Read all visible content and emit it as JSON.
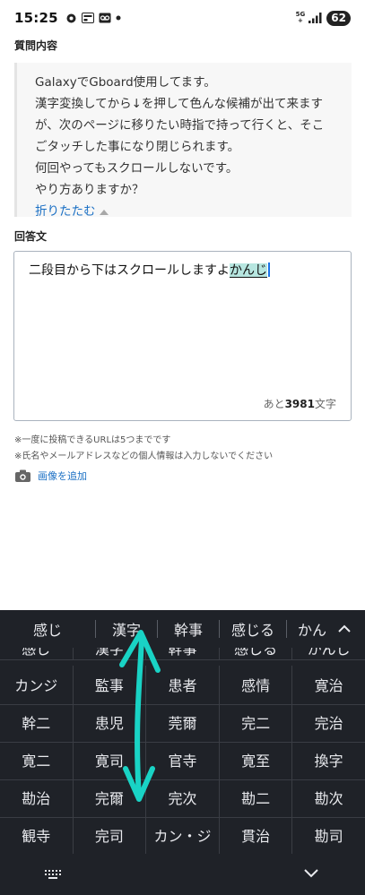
{
  "status_bar": {
    "time": "15:25",
    "network_top": "5G",
    "network_bottom": "+",
    "battery": "62"
  },
  "question": {
    "label": "質問内容",
    "lines": [
      "GalaxyでGboard使用してます。",
      "漢字変換してから↓を押して色んな候補が出て来ます",
      "が、次のページに移りたい時指で持って行くと、そこ",
      "ごタッチした事になり閉じられます。",
      "何回やってもスクロールしないです。",
      "やり方ありますか？"
    ],
    "collapse_label": "折りたたむ"
  },
  "answer": {
    "label": "回答文",
    "text_committed": "二段目から下はスクロールしますよ",
    "text_composing": "かんじ",
    "count_prefix": "あと",
    "count_value": "3981",
    "count_suffix": "文字"
  },
  "notes": [
    "※一度に投稿できるURLは5つまでです",
    "※氏名やメールアドレスなどの個人情報は入力しないでください"
  ],
  "add_image_label": "画像を追加",
  "keyboard": {
    "suggestions": [
      "感じ",
      "漢字",
      "幹事",
      "感じる",
      "かん"
    ],
    "partial_row": [
      "感じ",
      "漢字",
      "幹事",
      "感じる",
      "かんじ"
    ],
    "candidate_rows": [
      [
        "カンジ",
        "監事",
        "患者",
        "感情",
        "寛治"
      ],
      [
        "幹二",
        "患児",
        "莞爾",
        "完二",
        "完治"
      ],
      [
        "寛二",
        "寛司",
        "官寺",
        "寛至",
        "換字"
      ],
      [
        "勘治",
        "完爾",
        "完次",
        "勘二",
        "勘次"
      ],
      [
        "観寺",
        "完司",
        "カン・ジ",
        "貫治",
        "勘司"
      ]
    ],
    "bg_color": "#1f2228",
    "text_color": "#e9eaee"
  },
  "annotation": {
    "color": "#19d3c5",
    "icon": "double-headed-arrow-icon"
  },
  "colors": {
    "link": "#1a6fc4",
    "composing_highlight": "#b7e6e0"
  }
}
